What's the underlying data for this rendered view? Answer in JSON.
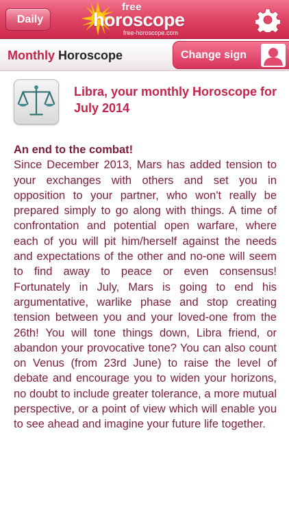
{
  "topbar": {
    "back_label": "Daily",
    "logo_free": "free",
    "logo_main": "horoscope",
    "logo_url": "free-horoscope.com",
    "settings_icon": "gear-icon",
    "color": "#e14766"
  },
  "subheader": {
    "title_accent": "Monthly",
    "title_rest": " Horoscope",
    "change_sign_label": "Change sign",
    "avatar_icon": "user-silhouette-icon"
  },
  "sign": {
    "icon": "libra-scales-icon",
    "title": "Libra, your monthly Horoscope for July 2014"
  },
  "content": {
    "heading": "An end to the combat!",
    "text": "Since December 2013, Mars has added tension to your exchanges with others and set you in opposition to your partner, who won't really be prepared simply to go along with things. A time of confrontation and potential open warfare, where each of you will pit him/herself against the needs and expectations of the other and no-one will seem to find away to peace or even consensus! Fortunately in July, Mars is going to end his argumentative, warlike phase and stop creating tension between you and your loved-one from the 26th! You will tone things down, Libra friend, or abandon your provocative tone? You can also count on Venus (from 23rd June) to raise the level of debate and encourage you to widen your horizons, no doubt to include greater tolerance, a more mutual perspective, or a point of view which will enable you to see ahead and imagine your future life together."
  },
  "colors": {
    "accent": "#c4234a",
    "body_text": "#7a1c3c"
  }
}
